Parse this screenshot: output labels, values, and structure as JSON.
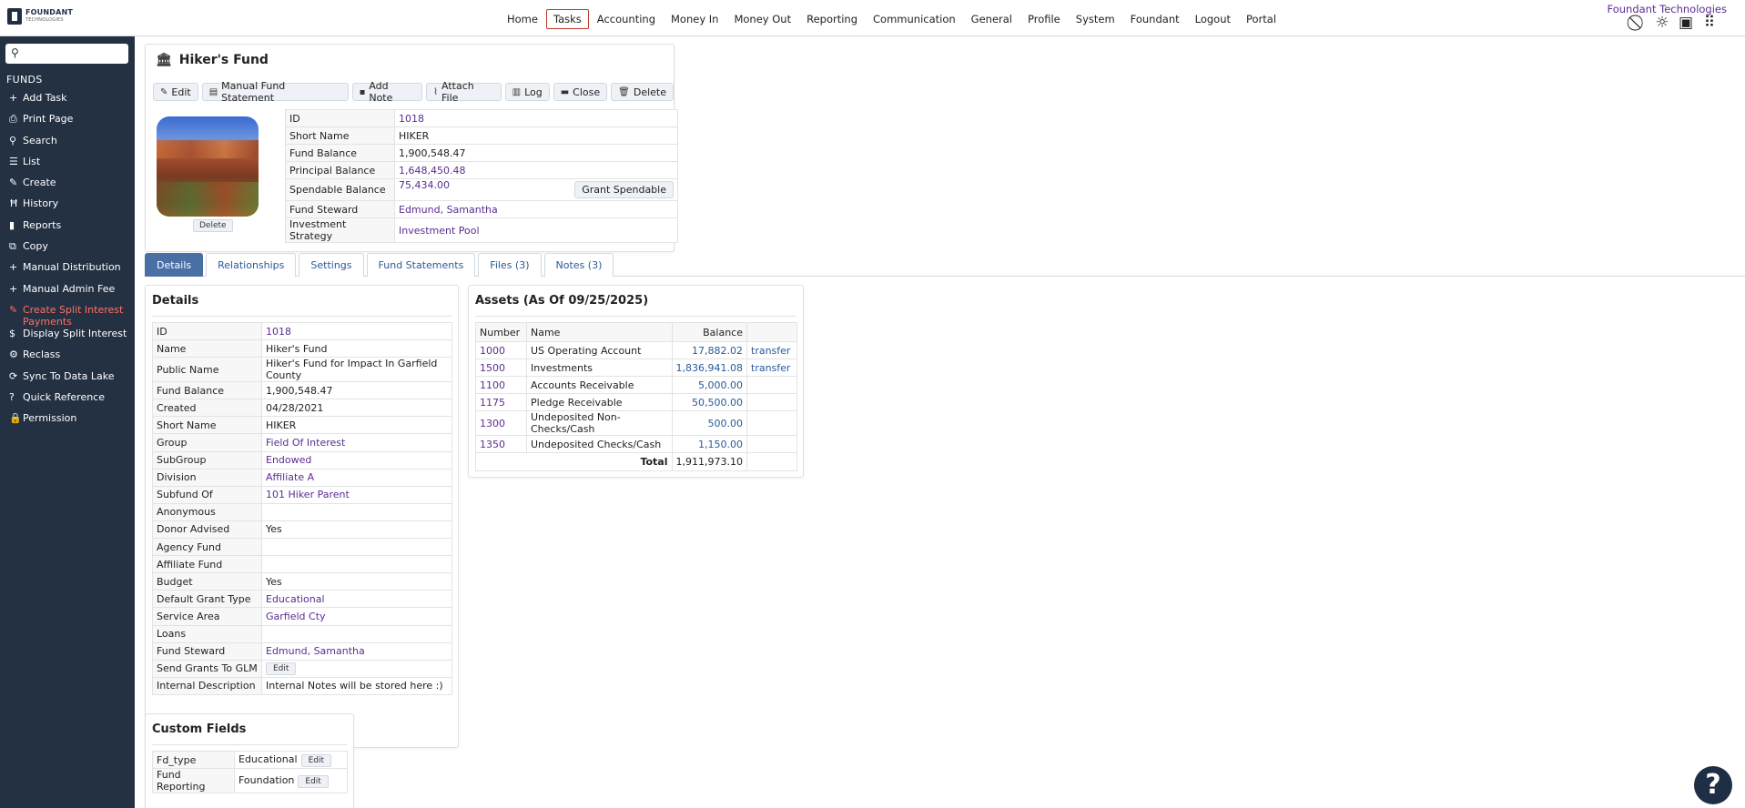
{
  "header": {
    "logo_text": "FOUNDANT",
    "logo_sub": "TECHNOLOGIES",
    "org_name": "Foundant Technologies",
    "nav": [
      "Home",
      "Tasks",
      "Accounting",
      "Money In",
      "Money Out",
      "Reporting",
      "Communication",
      "General",
      "Profile",
      "System",
      "Foundant",
      "Logout",
      "Portal"
    ],
    "active_nav": "Tasks",
    "icons": [
      "no-activity-icon",
      "lightbulb-icon",
      "gift-icon",
      "apps-grid-icon"
    ]
  },
  "sidebar": {
    "search_placeholder": "",
    "section": "FUNDS",
    "items": [
      {
        "label": "Add Task",
        "icon": "plus-icon"
      },
      {
        "label": "Print Page",
        "icon": "print-icon"
      },
      {
        "label": "Search",
        "icon": "search-icon"
      },
      {
        "label": "List",
        "icon": "list-icon"
      },
      {
        "label": "Create",
        "icon": "pencil-icon"
      },
      {
        "label": "History",
        "icon": "history-icon"
      },
      {
        "label": "Reports",
        "icon": "bar-chart-icon"
      },
      {
        "label": "Copy",
        "icon": "copy-icon"
      },
      {
        "label": "Manual Distribution",
        "icon": "plus-icon"
      },
      {
        "label": "Manual Admin Fee",
        "icon": "plus-icon"
      },
      {
        "label": "Create Split Interest Payments",
        "icon": "pencil-icon",
        "highlight": true
      },
      {
        "label": "Display Split Interest",
        "icon": "dollar-icon"
      },
      {
        "label": "Reclass",
        "icon": "gear-icon"
      },
      {
        "label": "Sync To Data Lake",
        "icon": "sync-icon"
      },
      {
        "label": "Quick Reference",
        "icon": "question-icon"
      },
      {
        "label": "Permission",
        "icon": "lock-icon"
      }
    ]
  },
  "fund": {
    "title": "Hiker's Fund",
    "actions": [
      {
        "label": "Edit",
        "icon": "edit-icon"
      },
      {
        "label": "Manual Fund Statement",
        "icon": "statement-icon"
      },
      {
        "label": "Add Note",
        "icon": "comment-icon"
      },
      {
        "label": "Attach File",
        "icon": "paperclip-icon"
      },
      {
        "label": "Log",
        "icon": "book-icon"
      },
      {
        "label": "Close",
        "icon": "folder-icon"
      },
      {
        "label": "Delete",
        "icon": "trash-icon"
      }
    ],
    "photo_delete": "Delete",
    "info": [
      {
        "k": "ID",
        "v": "1018",
        "link": true
      },
      {
        "k": "Short Name",
        "v": "HIKER"
      },
      {
        "k": "Fund Balance",
        "v": "1,900,548.47"
      },
      {
        "k": "Principal Balance",
        "v": "1,648,450.48",
        "link": true
      },
      {
        "k": "Spendable Balance",
        "v": "75,434.00",
        "link": true,
        "button": "Grant Spendable"
      },
      {
        "k": "Fund Steward",
        "v": "Edmund, Samantha",
        "link": true
      },
      {
        "k": "Investment Strategy",
        "v": "Investment Pool",
        "link": true
      }
    ]
  },
  "tabs": [
    {
      "label": "Details",
      "active": true
    },
    {
      "label": "Relationships"
    },
    {
      "label": "Settings"
    },
    {
      "label": "Fund Statements"
    },
    {
      "label": "Files (3)"
    },
    {
      "label": "Notes (3)"
    }
  ],
  "details": {
    "title": "Details",
    "rows": [
      {
        "k": "ID",
        "v": "1018",
        "link": true
      },
      {
        "k": "Name",
        "v": "Hiker's Fund"
      },
      {
        "k": "Public Name",
        "v": "Hiker's Fund for Impact In Garfield County"
      },
      {
        "k": "Fund Balance",
        "v": "1,900,548.47"
      },
      {
        "k": "Created",
        "v": "04/28/2021"
      },
      {
        "k": "Short Name",
        "v": "HIKER"
      },
      {
        "k": "Group",
        "v": "Field Of Interest",
        "link": true
      },
      {
        "k": "SubGroup",
        "v": "Endowed",
        "link": true
      },
      {
        "k": "Division",
        "v": "Affiliate A",
        "link": true
      },
      {
        "k": "Subfund Of",
        "v": "101 Hiker Parent",
        "link": true
      },
      {
        "k": "Anonymous",
        "v": ""
      },
      {
        "k": "Donor Advised",
        "v": "Yes"
      },
      {
        "k": "Agency Fund",
        "v": ""
      },
      {
        "k": "Affiliate Fund",
        "v": ""
      },
      {
        "k": "Budget",
        "v": "Yes"
      },
      {
        "k": "Default Grant Type",
        "v": "Educational",
        "link": true
      },
      {
        "k": "Service Area",
        "v": "Garfield Cty",
        "link": true
      },
      {
        "k": "Loans",
        "v": ""
      },
      {
        "k": "Fund Steward",
        "v": "Edmund, Samantha",
        "link": true
      },
      {
        "k": "Send Grants To GLM",
        "v": "",
        "button": "Edit"
      },
      {
        "k": "Internal Description",
        "v": "Internal Notes will be stored here :)"
      }
    ]
  },
  "assets": {
    "title": "Assets (As Of 09/25/2025)",
    "columns": [
      "Number",
      "Name",
      "Balance",
      ""
    ],
    "rows": [
      {
        "number": "1000",
        "name": "US Operating Account",
        "balance": "17,882.02",
        "action": "transfer"
      },
      {
        "number": "1500",
        "name": "Investments",
        "balance": "1,836,941.08",
        "action": "transfer"
      },
      {
        "number": "1100",
        "name": "Accounts Receivable",
        "balance": "5,000.00",
        "action": ""
      },
      {
        "number": "1175",
        "name": "Pledge Receivable",
        "balance": "50,500.00",
        "action": ""
      },
      {
        "number": "1300",
        "name": "Undeposited Non-Checks/Cash",
        "balance": "500.00",
        "action": ""
      },
      {
        "number": "1350",
        "name": "Undeposited Checks/Cash",
        "balance": "1,150.00",
        "action": ""
      }
    ],
    "total_label": "Total",
    "total_value": "1,911,973.10"
  },
  "custom_fields": {
    "title": "Custom Fields",
    "rows": [
      {
        "k": "Fd_type",
        "v": "Educational",
        "button": "Edit"
      },
      {
        "k": "Fund Reporting",
        "v": "Foundation",
        "button": "Edit"
      }
    ]
  },
  "help_label": "?",
  "colors": {
    "sidebar": "#233143",
    "accent": "#4a6fa5",
    "link": "#5b2d90",
    "highlight": "#ff6f61"
  }
}
